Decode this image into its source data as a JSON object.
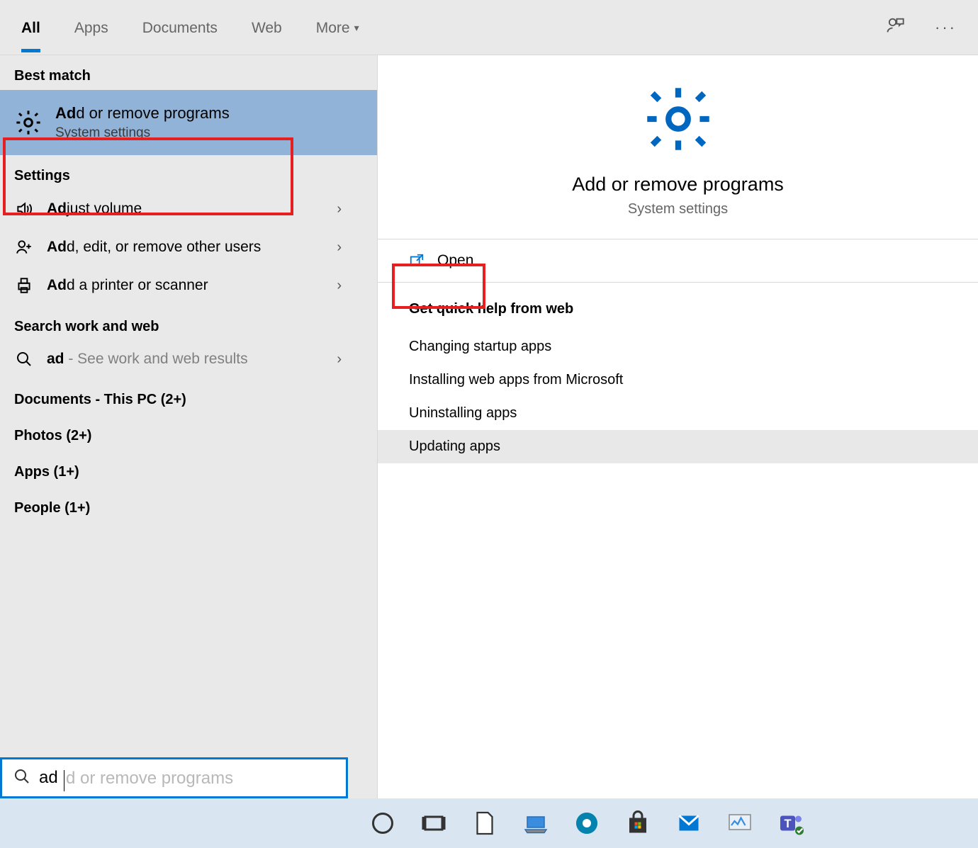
{
  "tabs": {
    "all": "All",
    "apps": "Apps",
    "documents": "Documents",
    "web": "Web",
    "more": "More"
  },
  "sections": {
    "best_match": "Best match",
    "settings": "Settings",
    "search_web": "Search work and web",
    "documents_pc": "Documents - This PC (2+)",
    "photos": "Photos (2+)",
    "apps": "Apps (1+)",
    "people": "People (1+)"
  },
  "best_match": {
    "title_bold": "Ad",
    "title_rest": "d or remove programs",
    "subtitle": "System settings"
  },
  "settings_items": [
    {
      "bold": "Ad",
      "rest": "just volume",
      "icon": "volume"
    },
    {
      "bold": "Ad",
      "rest": "d, edit, or remove other users",
      "icon": "user-plus"
    },
    {
      "bold": "Ad",
      "rest": "d a printer or scanner",
      "icon": "printer"
    }
  ],
  "web_item": {
    "bold": "ad",
    "rest": " - See work and web results"
  },
  "detail": {
    "title": "Add or remove programs",
    "subtitle": "System settings",
    "open": "Open",
    "quick_help_title": "Get quick help from web",
    "help_links": [
      "Changing startup apps",
      "Installing web apps from Microsoft",
      "Uninstalling apps",
      "Updating apps"
    ]
  },
  "search": {
    "typed": "ad",
    "ghost": "d or remove programs"
  }
}
